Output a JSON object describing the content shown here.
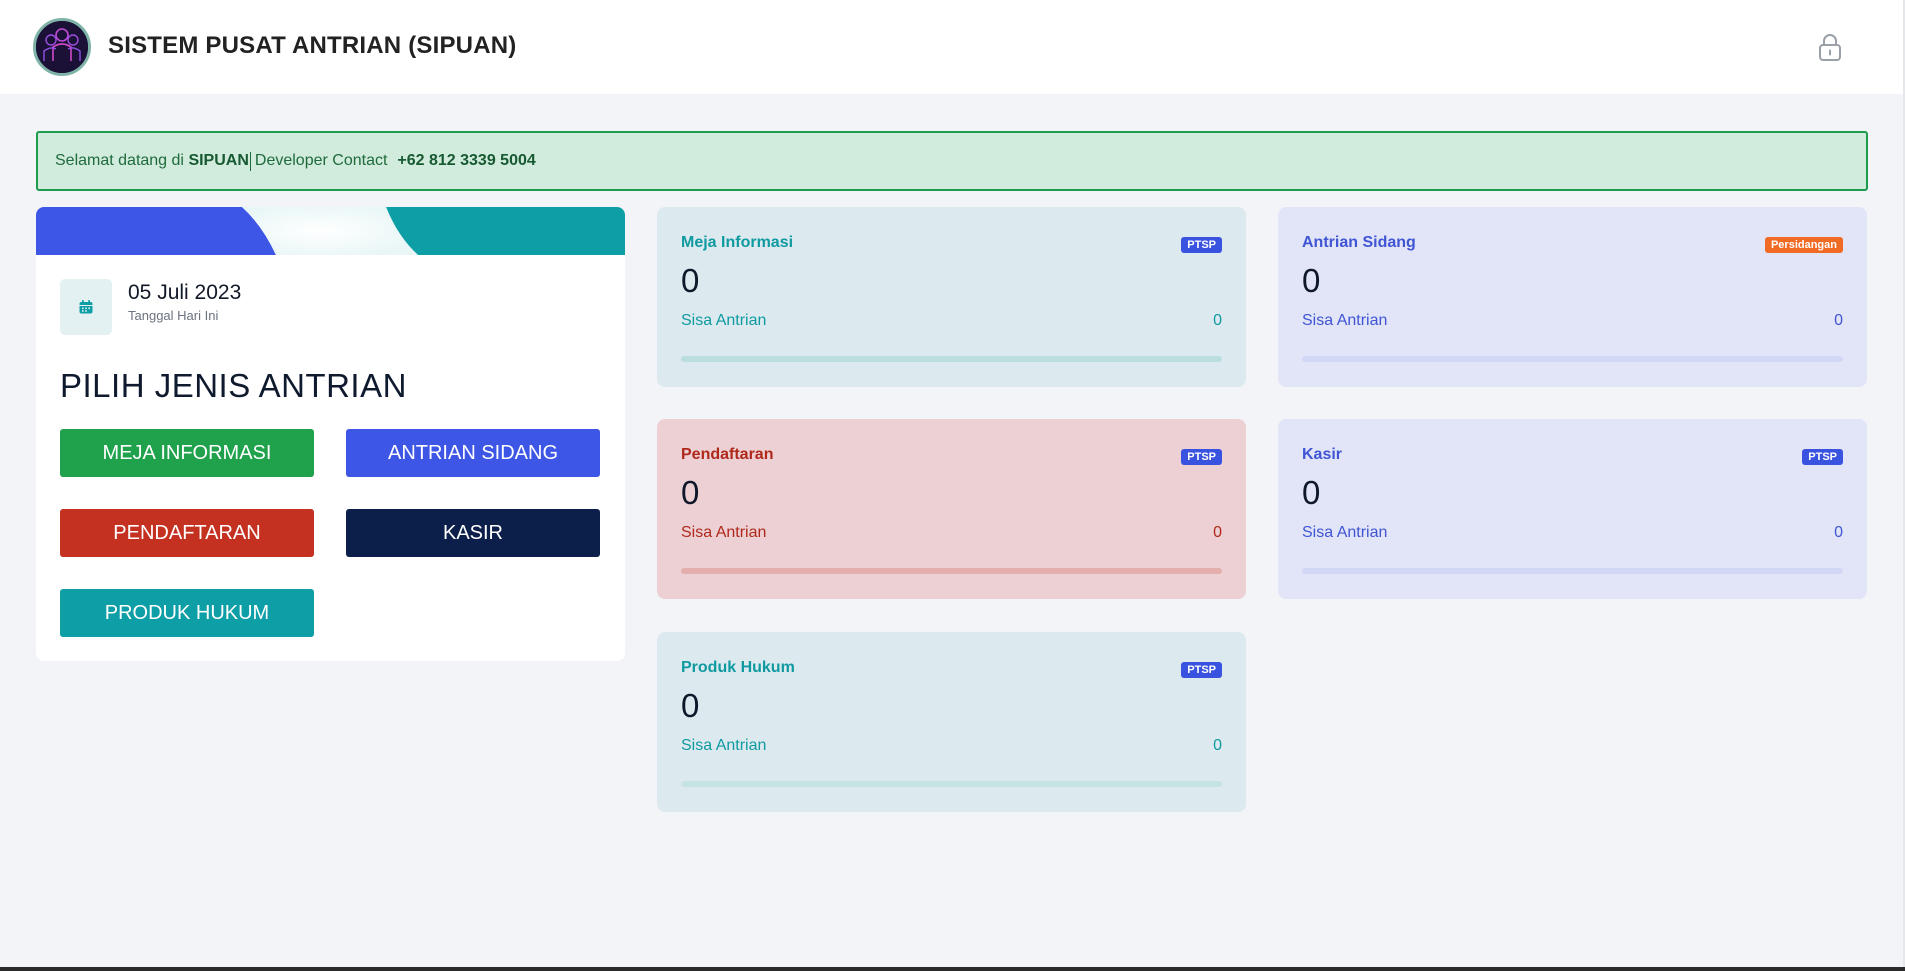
{
  "header": {
    "title": "SISTEM PUSAT ANTRIAN (SIPUAN)",
    "logo_text": "SIPUAN",
    "logo_icon": "people-logo-icon",
    "lock_icon": "lock-icon"
  },
  "alert": {
    "prefix": "Selamat datang di",
    "brand": "SIPUAN",
    "contact_label": "Developer Contact",
    "contact_number": "+62 812 3339 5004"
  },
  "left_card": {
    "date_value": "05 Juli 2023",
    "date_caption": "Tanggal Hari Ini",
    "date_icon": "calendar-icon",
    "title": "PILIH JENIS ANTRIAN",
    "buttons": {
      "meja": "MEJA INFORMASI",
      "sidang": "ANTRIAN SIDANG",
      "pendaftaran": "PENDAFTARAN",
      "kasir": "KASIR",
      "produk": "PRODUK HUKUM"
    }
  },
  "stats": {
    "meja": {
      "name": "Meja Informasi",
      "badge": "PTSP",
      "count": "0",
      "sub_label": "Sisa Antrian",
      "sub_value": "0",
      "progress": 0
    },
    "sidang": {
      "name": "Antrian Sidang",
      "badge": "Persidangan",
      "count": "0",
      "sub_label": "Sisa Antrian",
      "sub_value": "0",
      "progress": 0
    },
    "pendaftaran": {
      "name": "Pendaftaran",
      "badge": "PTSP",
      "count": "0",
      "sub_label": "Sisa Antrian",
      "sub_value": "0",
      "progress": 0
    },
    "kasir": {
      "name": "Kasir",
      "badge": "PTSP",
      "count": "0",
      "sub_label": "Sisa Antrian",
      "sub_value": "0",
      "progress": 0
    },
    "produk": {
      "name": "Produk Hukum",
      "badge": "PTSP",
      "count": "0",
      "sub_label": "Sisa Antrian",
      "sub_value": "0",
      "progress": 0
    }
  },
  "colors": {
    "green": "#1fa24b",
    "blue": "#3d56e6",
    "red": "#c43121",
    "navy": "#0c1f4a",
    "teal": "#0e9ea6",
    "orange": "#f06a24"
  }
}
